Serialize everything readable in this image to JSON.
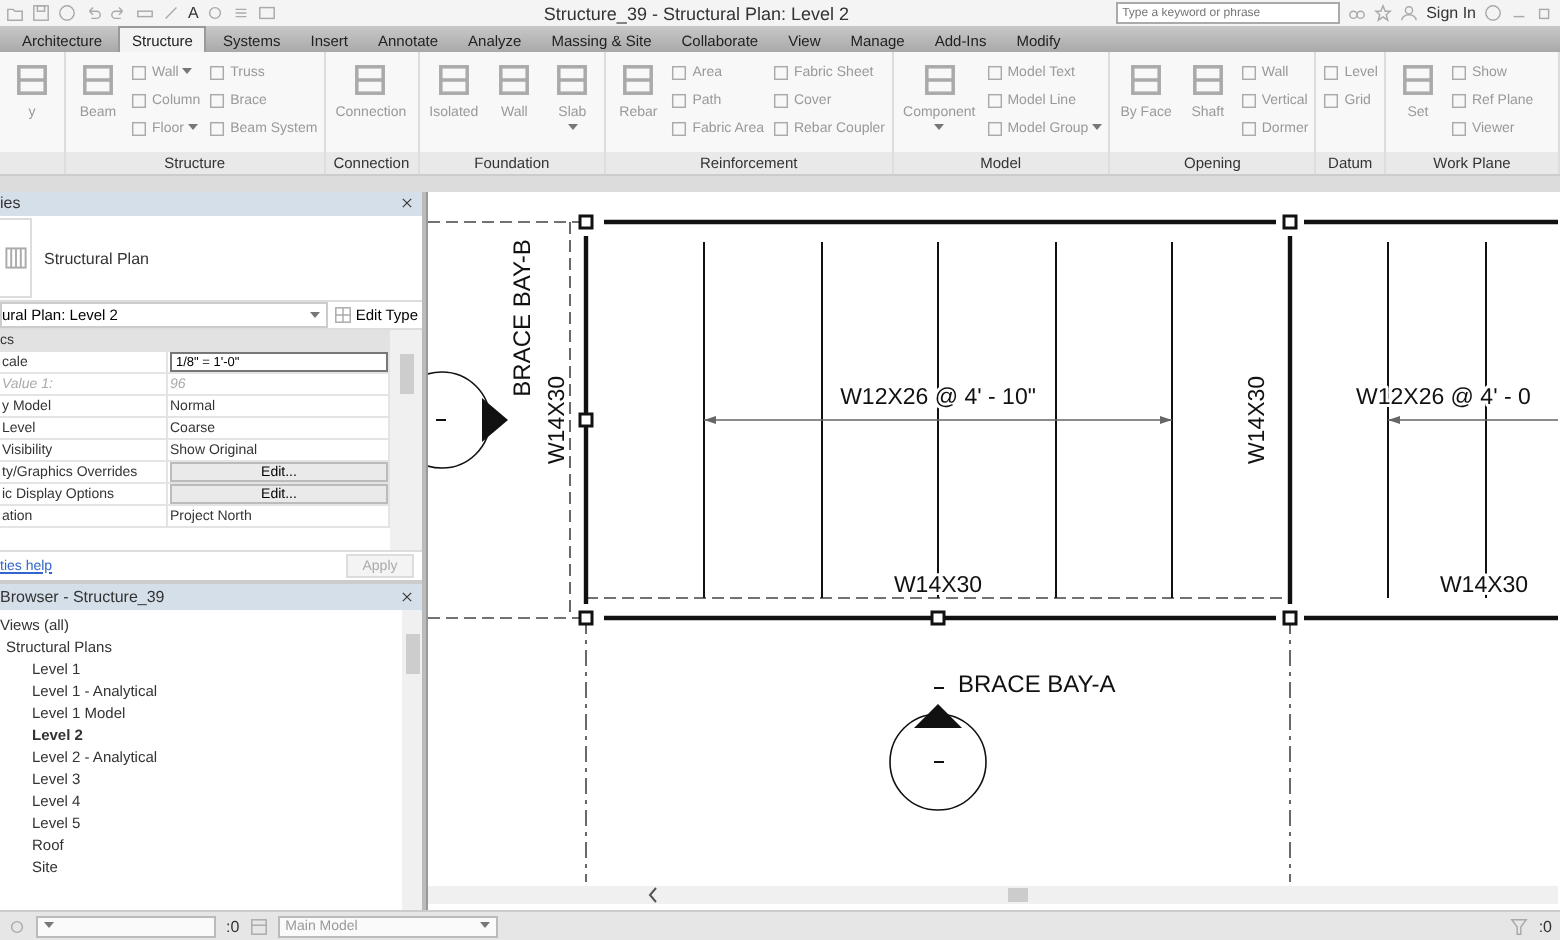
{
  "window": {
    "title": "Structure_39 - Structural Plan: Level 2",
    "quick_access_text": "A",
    "search": {
      "placeholder": "Type a keyword or phrase"
    },
    "sign_in": "Sign In"
  },
  "tabs": [
    {
      "label": "Architecture",
      "selected": false
    },
    {
      "label": "Structure",
      "selected": true
    },
    {
      "label": "Systems",
      "selected": false
    },
    {
      "label": "Insert",
      "selected": false
    },
    {
      "label": "Annotate",
      "selected": false
    },
    {
      "label": "Analyze",
      "selected": false
    },
    {
      "label": "Massing & Site",
      "selected": false
    },
    {
      "label": "Collaborate",
      "selected": false
    },
    {
      "label": "View",
      "selected": false
    },
    {
      "label": "Manage",
      "selected": false
    },
    {
      "label": "Add-Ins",
      "selected": false
    },
    {
      "label": "Modify",
      "selected": false
    }
  ],
  "ribbon": [
    {
      "buttons": [
        {
          "label": "y",
          "kind": "large"
        }
      ]
    },
    {
      "title": "Structure",
      "buttons": [
        {
          "label": "Beam",
          "kind": "large"
        },
        {
          "label": "Wall",
          "kind": "small",
          "dropdown": true
        },
        {
          "label": "Column",
          "kind": "small"
        },
        {
          "label": "Floor",
          "kind": "small",
          "dropdown": true
        },
        {
          "label": "Truss",
          "kind": "small"
        },
        {
          "label": "Brace",
          "kind": "small"
        },
        {
          "label": "Beam System",
          "kind": "small"
        }
      ]
    },
    {
      "title": "Connection",
      "buttons": [
        {
          "label": "Connection",
          "kind": "large"
        }
      ]
    },
    {
      "title": "Foundation",
      "buttons": [
        {
          "label": "Isolated",
          "kind": "large"
        },
        {
          "label": "Wall",
          "kind": "large"
        },
        {
          "label": "Slab",
          "kind": "large",
          "dropdown": true
        }
      ]
    },
    {
      "title": "Reinforcement",
      "buttons": [
        {
          "label": "Rebar",
          "kind": "large"
        },
        {
          "label": "Area",
          "kind": "small"
        },
        {
          "label": "Path",
          "kind": "small"
        },
        {
          "label": "Fabric Area",
          "kind": "small"
        },
        {
          "label": "Fabric Sheet",
          "kind": "small"
        },
        {
          "label": "Cover",
          "kind": "small"
        },
        {
          "label": "Rebar Coupler",
          "kind": "small"
        }
      ]
    },
    {
      "title": "Model",
      "buttons": [
        {
          "label": "Component",
          "kind": "large",
          "dropdown": true
        },
        {
          "label": "Model Text",
          "kind": "small"
        },
        {
          "label": "Model Line",
          "kind": "small"
        },
        {
          "label": "Model Group",
          "kind": "small",
          "dropdown": true
        }
      ]
    },
    {
      "title": "Opening",
      "buttons": [
        {
          "label": "By Face",
          "kind": "large"
        },
        {
          "label": "Shaft",
          "kind": "large"
        },
        {
          "label": "Wall",
          "kind": "small"
        },
        {
          "label": "Vertical",
          "kind": "small"
        },
        {
          "label": "Dormer",
          "kind": "small"
        }
      ]
    },
    {
      "title": "Datum",
      "buttons": [
        {
          "label": "Level",
          "kind": "small"
        },
        {
          "label": "Grid",
          "kind": "small"
        }
      ]
    },
    {
      "title": "Work Plane",
      "buttons": [
        {
          "label": "Set",
          "kind": "large"
        },
        {
          "label": "Show",
          "kind": "small"
        },
        {
          "label": "Ref Plane",
          "kind": "small"
        },
        {
          "label": "Viewer",
          "kind": "small"
        }
      ]
    }
  ],
  "properties": {
    "title": "ies",
    "type_name": "Structural Plan",
    "instance": "ural Plan: Level 2",
    "edit_type": "Edit Type",
    "group": "cs",
    "rows": [
      {
        "label": "cale",
        "value": "1/8\" = 1'-0\"",
        "kind": "input",
        "disabled": false
      },
      {
        "label": "Value  1:",
        "value": "96",
        "kind": "text",
        "disabled": true
      },
      {
        "label": "y Model",
        "value": "Normal",
        "kind": "text",
        "disabled": false
      },
      {
        "label": "Level",
        "value": "Coarse",
        "kind": "text",
        "disabled": false
      },
      {
        "label": "Visibility",
        "value": "Show Original",
        "kind": "text",
        "disabled": false
      },
      {
        "label": "ty/Graphics Overrides",
        "value": "Edit...",
        "kind": "button",
        "disabled": false
      },
      {
        "label": "ic Display Options",
        "value": "Edit...",
        "kind": "button",
        "disabled": false
      },
      {
        "label": "ation",
        "value": "Project North",
        "kind": "text",
        "disabled": false
      }
    ],
    "help_link": "ties help",
    "apply": "Apply"
  },
  "browser": {
    "title": "Browser - Structure_39",
    "tree": [
      {
        "label": "Views (all)",
        "selected": false,
        "children": [
          {
            "label": "Structural Plans",
            "selected": false,
            "children": [
              {
                "label": "Level 1",
                "selected": false
              },
              {
                "label": "Level 1 - Analytical",
                "selected": false
              },
              {
                "label": "Level 1 Model",
                "selected": false
              },
              {
                "label": "Level 2",
                "selected": true
              },
              {
                "label": "Level 2 - Analytical",
                "selected": false
              },
              {
                "label": "Level 3",
                "selected": false
              },
              {
                "label": "Level 4",
                "selected": false
              },
              {
                "label": "Level 5",
                "selected": false
              },
              {
                "label": "Roof",
                "selected": false
              },
              {
                "label": "Site",
                "selected": false
              }
            ]
          }
        ]
      }
    ]
  },
  "canvas": {
    "bay_labels": [
      "BRACE BAY-B",
      "BRACE BAY-A"
    ],
    "beam_labels": [
      "W14X30",
      "W14X30",
      "W14X30",
      "W14X30"
    ],
    "joist_labels": [
      "W12X26 @ 4' - 10\"",
      "W12X26 @ 4' - 0"
    ]
  },
  "status_bar": {
    "selection_count": ":0",
    "model": "Main Model",
    "filter_count": ":0"
  }
}
